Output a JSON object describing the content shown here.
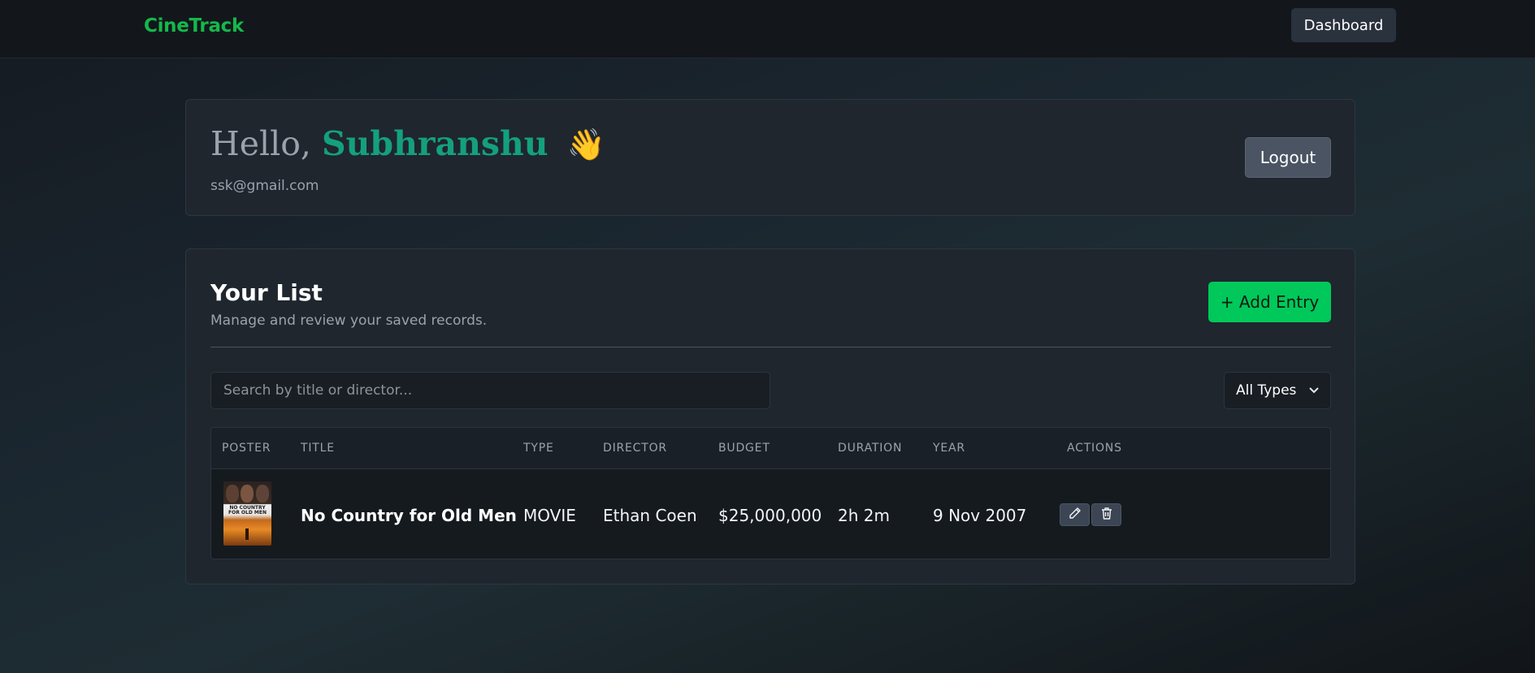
{
  "header": {
    "brand": "CineTrack",
    "dashboard_label": "Dashboard"
  },
  "profile": {
    "greeting": "Hello,",
    "name": "Subhranshu",
    "wave": "👋",
    "email": "ssk@gmail.com",
    "logout_label": "Logout"
  },
  "list": {
    "title": "Your List",
    "subtitle": "Manage and review your saved records.",
    "add_label": "+ Add Entry",
    "search_placeholder": "Search by title or director...",
    "filter": {
      "selected": "All Types"
    },
    "columns": [
      "POSTER",
      "TITLE",
      "TYPE",
      "DIRECTOR",
      "BUDGET",
      "DURATION",
      "YEAR",
      "ACTIONS"
    ],
    "rows": [
      {
        "poster_text": "NO COUNTRY FOR OLD MEN",
        "title": "No Country for Old Men",
        "type": "MOVIE",
        "director": "Ethan Coen",
        "budget": "$25,000,000",
        "duration": "2h 2m",
        "year": "9 Nov 2007",
        "actions": [
          "pencil-icon",
          "trash-icon"
        ]
      }
    ]
  },
  "colors": {
    "brand": "#16b84a",
    "name_accent": "#14a07d",
    "add_button": "#00c85a"
  }
}
